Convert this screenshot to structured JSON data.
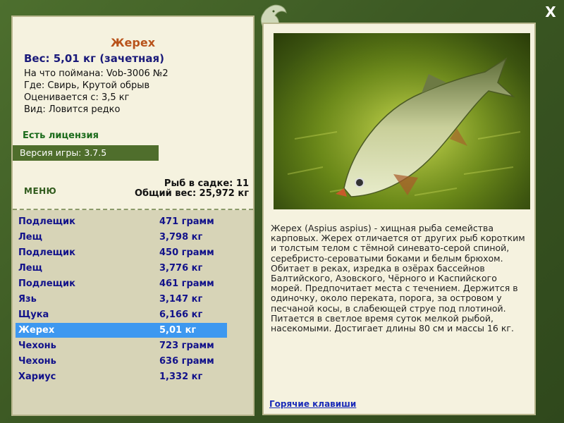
{
  "fish": {
    "name": "Жерех",
    "weight": "Вес: 5,01 кг (зачетная)",
    "caught_with": "На что поймана: Vob-3006 №2",
    "location": "Где: Свирь, Крутой обрыв",
    "valued_from": "Оценивается с: 3,5 кг",
    "rarity": "Вид: Ловится редко"
  },
  "license": "Есть лицензия",
  "version": "Версия игры: 3.7.5",
  "menu_label": "МЕНЮ",
  "stats": {
    "count": "Рыб в садке: 11",
    "total": "Общий вес: 25,972 кг"
  },
  "catch": [
    {
      "name": "Подлещик",
      "weight": "471 грамм"
    },
    {
      "name": "Лещ",
      "weight": "3,798 кг"
    },
    {
      "name": "Подлещик",
      "weight": "450 грамм"
    },
    {
      "name": "Лещ",
      "weight": "3,776 кг"
    },
    {
      "name": "Подлещик",
      "weight": "461 грамм"
    },
    {
      "name": "Язь",
      "weight": "3,147 кг"
    },
    {
      "name": "Щука",
      "weight": "6,166 кг"
    },
    {
      "name": "Жерех",
      "weight": "5,01 кг"
    },
    {
      "name": "Чехонь",
      "weight": "723 грамм"
    },
    {
      "name": "Чехонь",
      "weight": "636 грамм"
    },
    {
      "name": "Хариус",
      "weight": "1,332 кг"
    }
  ],
  "selected_index": 7,
  "description": "Жерех (Aspius aspius) - хищная рыба семейства карповых. Жерех отличается от других рыб коротким и толстым телом с тёмной синевато-серой спиной, серебристо-сероватыми боками и белым брюхом. Обитает в реках, изредка в озёрах бассейнов Балтийского, Азовского, Чёрного и Каспийского морей. Предпочитает места с течением. Держится в одиночку, около переката, порога, за островом у песчаной косы, в слабеющей струе под плотиной. Питается в светлое время суток мелкой рыбой, насекомыми. Достигает длины 80 см и массы 16 кг.",
  "hotkeys_label": "Горячие клавиши",
  "close_label": "X",
  "colors": {
    "frame": "#3e5b26",
    "panel": "#f5f2df",
    "title": "#b8521a",
    "selection": "#3d98f0",
    "list_text": "#12128a"
  }
}
